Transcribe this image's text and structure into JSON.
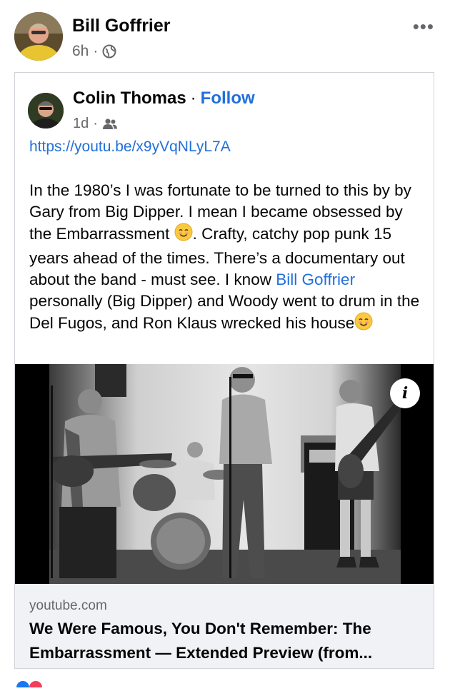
{
  "post": {
    "author": "Bill Goffrier",
    "time": "6h",
    "audience_icon": "globe-icon",
    "more_icon": "more-options-icon"
  },
  "shared": {
    "author": "Colin Thomas",
    "follow_label": "Follow",
    "time": "1d",
    "audience_icon": "friends-icon",
    "link": "https://youtu.be/x9yVqNLyL7A",
    "text_1": "In the 1980’s I was fortunate to be turned to this by by Gary from Big Dipper.  I mean I became obsessed by the Embarrassment ",
    "text_2": ".  Crafty, catchy pop punk 15 years ahead of the times.  There’s a documentary out about the band - must see.  I know ",
    "mention": "Bill Goffrier",
    "text_3": " personally (Big Dipper) and Woody went to drum in the Del Fugos, and Ron Klaus wrecked his house",
    "emoji": "smiling-face-icon"
  },
  "link_preview": {
    "domain": "youtube.com",
    "title": "We Were Famous, You Don't Remember: The Embarrassment — Extended Preview (from...",
    "info_label": "i"
  }
}
